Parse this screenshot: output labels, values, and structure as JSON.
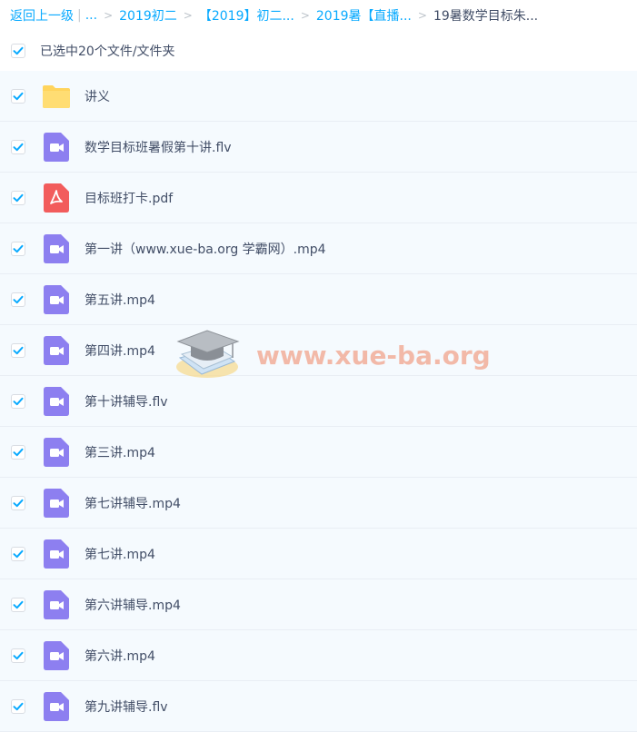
{
  "breadcrumb": {
    "back": "返回上一级",
    "ellipsis": "...",
    "items": [
      "2019初二",
      "【2019】初二...",
      "2019暑【直播..."
    ],
    "current": "19暑数学目标朱..."
  },
  "selection": {
    "label": "已选中20个文件/文件夹"
  },
  "files": [
    {
      "name": "讲义",
      "type": "folder"
    },
    {
      "name": "数学目标班暑假第十讲.flv",
      "type": "video"
    },
    {
      "name": "目标班打卡.pdf",
      "type": "pdf"
    },
    {
      "name": "第一讲（www.xue-ba.org 学霸网）.mp4",
      "type": "video"
    },
    {
      "name": "第五讲.mp4",
      "type": "video"
    },
    {
      "name": "第四讲.mp4",
      "type": "video"
    },
    {
      "name": "第十讲辅导.flv",
      "type": "video"
    },
    {
      "name": "第三讲.mp4",
      "type": "video"
    },
    {
      "name": "第七讲辅导.mp4",
      "type": "video"
    },
    {
      "name": "第七讲.mp4",
      "type": "video"
    },
    {
      "name": "第六讲辅导.mp4",
      "type": "video"
    },
    {
      "name": "第六讲.mp4",
      "type": "video"
    },
    {
      "name": "第九讲辅导.flv",
      "type": "video"
    }
  ],
  "watermark": {
    "text": "www.xue-ba.org"
  },
  "colors": {
    "accent": "#09aaff",
    "folder": "#ffd45c",
    "video": "#8d7ff0",
    "pdf": "#f25c5c"
  }
}
